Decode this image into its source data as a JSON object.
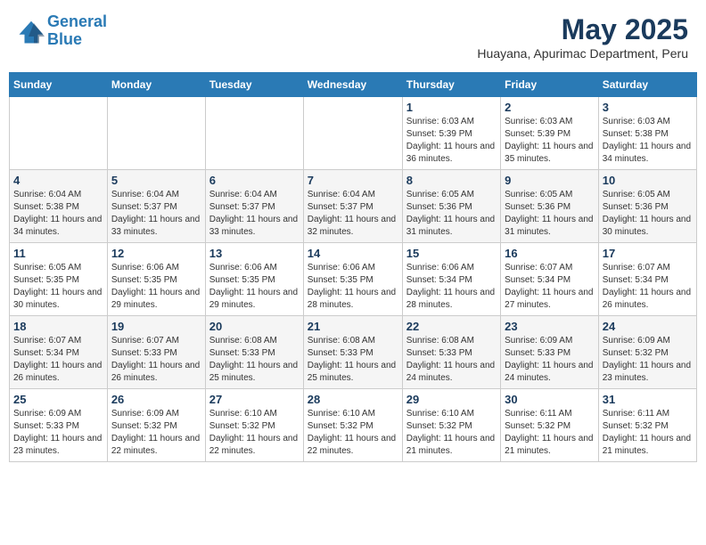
{
  "header": {
    "logo_line1": "General",
    "logo_line2": "Blue",
    "title": "May 2025",
    "subtitle": "Huayana, Apurimac Department, Peru"
  },
  "days_of_week": [
    "Sunday",
    "Monday",
    "Tuesday",
    "Wednesday",
    "Thursday",
    "Friday",
    "Saturday"
  ],
  "weeks": [
    [
      {
        "day": "",
        "info": ""
      },
      {
        "day": "",
        "info": ""
      },
      {
        "day": "",
        "info": ""
      },
      {
        "day": "",
        "info": ""
      },
      {
        "day": "1",
        "info": "Sunrise: 6:03 AM\nSunset: 5:39 PM\nDaylight: 11 hours and 36 minutes."
      },
      {
        "day": "2",
        "info": "Sunrise: 6:03 AM\nSunset: 5:39 PM\nDaylight: 11 hours and 35 minutes."
      },
      {
        "day": "3",
        "info": "Sunrise: 6:03 AM\nSunset: 5:38 PM\nDaylight: 11 hours and 34 minutes."
      }
    ],
    [
      {
        "day": "4",
        "info": "Sunrise: 6:04 AM\nSunset: 5:38 PM\nDaylight: 11 hours and 34 minutes."
      },
      {
        "day": "5",
        "info": "Sunrise: 6:04 AM\nSunset: 5:37 PM\nDaylight: 11 hours and 33 minutes."
      },
      {
        "day": "6",
        "info": "Sunrise: 6:04 AM\nSunset: 5:37 PM\nDaylight: 11 hours and 33 minutes."
      },
      {
        "day": "7",
        "info": "Sunrise: 6:04 AM\nSunset: 5:37 PM\nDaylight: 11 hours and 32 minutes."
      },
      {
        "day": "8",
        "info": "Sunrise: 6:05 AM\nSunset: 5:36 PM\nDaylight: 11 hours and 31 minutes."
      },
      {
        "day": "9",
        "info": "Sunrise: 6:05 AM\nSunset: 5:36 PM\nDaylight: 11 hours and 31 minutes."
      },
      {
        "day": "10",
        "info": "Sunrise: 6:05 AM\nSunset: 5:36 PM\nDaylight: 11 hours and 30 minutes."
      }
    ],
    [
      {
        "day": "11",
        "info": "Sunrise: 6:05 AM\nSunset: 5:35 PM\nDaylight: 11 hours and 30 minutes."
      },
      {
        "day": "12",
        "info": "Sunrise: 6:06 AM\nSunset: 5:35 PM\nDaylight: 11 hours and 29 minutes."
      },
      {
        "day": "13",
        "info": "Sunrise: 6:06 AM\nSunset: 5:35 PM\nDaylight: 11 hours and 29 minutes."
      },
      {
        "day": "14",
        "info": "Sunrise: 6:06 AM\nSunset: 5:35 PM\nDaylight: 11 hours and 28 minutes."
      },
      {
        "day": "15",
        "info": "Sunrise: 6:06 AM\nSunset: 5:34 PM\nDaylight: 11 hours and 28 minutes."
      },
      {
        "day": "16",
        "info": "Sunrise: 6:07 AM\nSunset: 5:34 PM\nDaylight: 11 hours and 27 minutes."
      },
      {
        "day": "17",
        "info": "Sunrise: 6:07 AM\nSunset: 5:34 PM\nDaylight: 11 hours and 26 minutes."
      }
    ],
    [
      {
        "day": "18",
        "info": "Sunrise: 6:07 AM\nSunset: 5:34 PM\nDaylight: 11 hours and 26 minutes."
      },
      {
        "day": "19",
        "info": "Sunrise: 6:07 AM\nSunset: 5:33 PM\nDaylight: 11 hours and 26 minutes."
      },
      {
        "day": "20",
        "info": "Sunrise: 6:08 AM\nSunset: 5:33 PM\nDaylight: 11 hours and 25 minutes."
      },
      {
        "day": "21",
        "info": "Sunrise: 6:08 AM\nSunset: 5:33 PM\nDaylight: 11 hours and 25 minutes."
      },
      {
        "day": "22",
        "info": "Sunrise: 6:08 AM\nSunset: 5:33 PM\nDaylight: 11 hours and 24 minutes."
      },
      {
        "day": "23",
        "info": "Sunrise: 6:09 AM\nSunset: 5:33 PM\nDaylight: 11 hours and 24 minutes."
      },
      {
        "day": "24",
        "info": "Sunrise: 6:09 AM\nSunset: 5:32 PM\nDaylight: 11 hours and 23 minutes."
      }
    ],
    [
      {
        "day": "25",
        "info": "Sunrise: 6:09 AM\nSunset: 5:33 PM\nDaylight: 11 hours and 23 minutes."
      },
      {
        "day": "26",
        "info": "Sunrise: 6:09 AM\nSunset: 5:32 PM\nDaylight: 11 hours and 22 minutes."
      },
      {
        "day": "27",
        "info": "Sunrise: 6:10 AM\nSunset: 5:32 PM\nDaylight: 11 hours and 22 minutes."
      },
      {
        "day": "28",
        "info": "Sunrise: 6:10 AM\nSunset: 5:32 PM\nDaylight: 11 hours and 22 minutes."
      },
      {
        "day": "29",
        "info": "Sunrise: 6:10 AM\nSunset: 5:32 PM\nDaylight: 11 hours and 21 minutes."
      },
      {
        "day": "30",
        "info": "Sunrise: 6:11 AM\nSunset: 5:32 PM\nDaylight: 11 hours and 21 minutes."
      },
      {
        "day": "31",
        "info": "Sunrise: 6:11 AM\nSunset: 5:32 PM\nDaylight: 11 hours and 21 minutes."
      }
    ]
  ]
}
